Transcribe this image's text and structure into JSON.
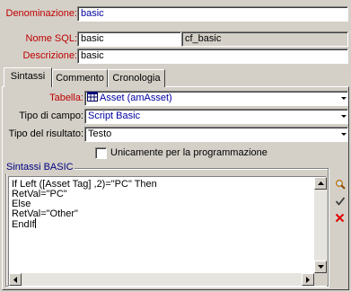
{
  "header": {
    "denominazione": {
      "label": "Denominazione:",
      "value": "basic"
    },
    "nome_sql": {
      "label": "Nome SQL:",
      "value": "basic",
      "extra_value": "cf_basic"
    },
    "descrizione": {
      "label": "Descrizione:",
      "value": "basic"
    }
  },
  "tabs": [
    {
      "label": "Sintassi",
      "active": true
    },
    {
      "label": "Commento",
      "active": false
    },
    {
      "label": "Cronologia",
      "active": false
    }
  ],
  "form": {
    "tabella": {
      "label": "Tabella:",
      "value": "Asset (amAsset)",
      "icon": "table-icon"
    },
    "tipo_campo": {
      "label": "Tipo di campo:",
      "value": "Script Basic"
    },
    "tipo_risultato": {
      "label": "Tipo del risultato:",
      "value": "Testo"
    },
    "programmazione": {
      "label": "Unicamente per la programmazione",
      "checked": false
    }
  },
  "script": {
    "group_label": "Sintassi BASIC",
    "lines": [
      "If Left ([Asset Tag] ,2)=\"PC\" Then",
      "RetVal=\"PC\"",
      "Else",
      "RetVal=\"Other\"",
      "EndIf"
    ]
  },
  "tools": {
    "search": "magnifier-icon",
    "validate": "checkmark-icon",
    "clear": "red-x-icon"
  },
  "colors": {
    "background": "#d4d0c8",
    "label_red": "#c00000",
    "value_blue": "#0000a0",
    "group_title": "#000080"
  }
}
